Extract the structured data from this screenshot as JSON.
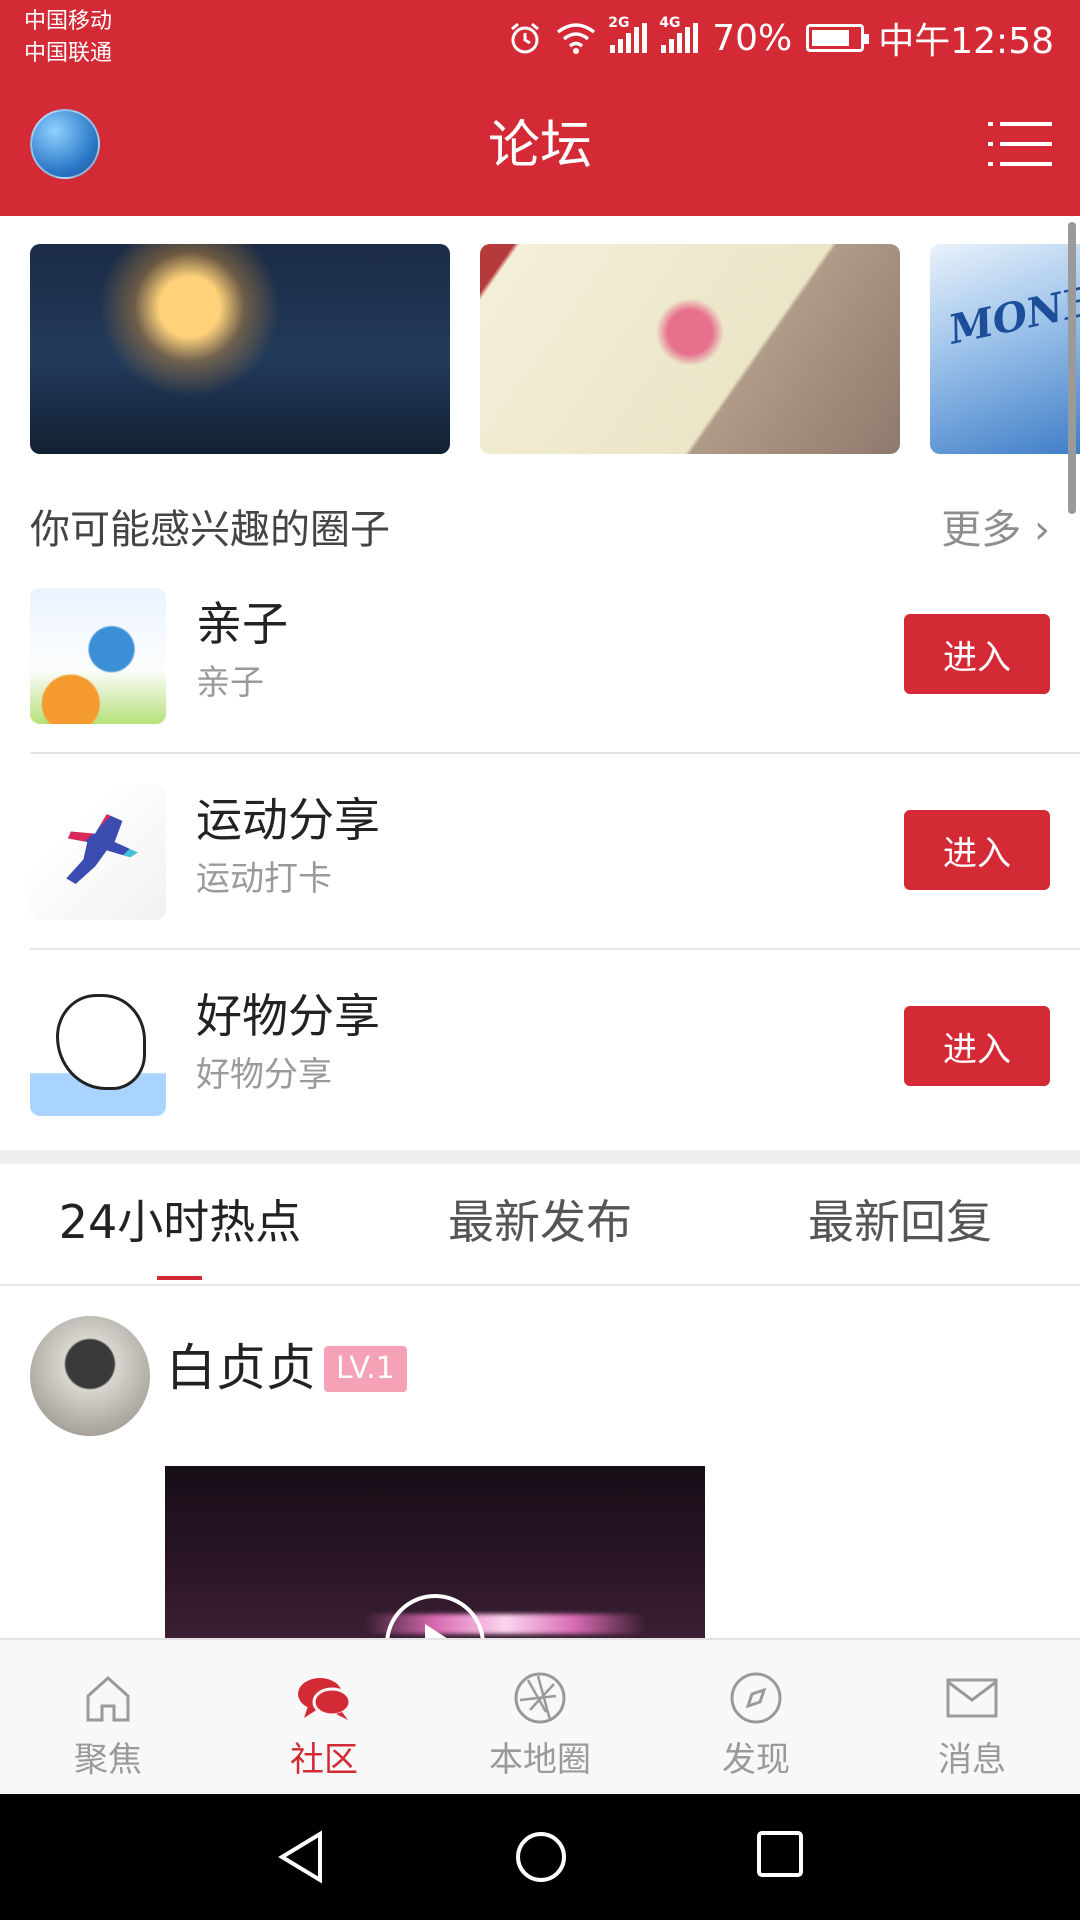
{
  "status_bar": {
    "carrier1": "中国移动",
    "carrier2": "中国联通",
    "net1": "2G",
    "net2": "4G",
    "battery": "70%",
    "battery_level": 0.7,
    "time": "中午12:58"
  },
  "header": {
    "title": "论坛"
  },
  "circles_section": {
    "title": "你可能感兴趣的圈子",
    "more": "更多",
    "items": [
      {
        "name": "亲子",
        "sub": "亲子",
        "button": "进入"
      },
      {
        "name": "运动分享",
        "sub": "运动打卡",
        "button": "进入"
      },
      {
        "name": "好物分享",
        "sub": "好物分享",
        "button": "进入"
      }
    ]
  },
  "banner": {
    "items": [
      "sky-lantern",
      "notebook-flower",
      "MONE"
    ]
  },
  "tabs": [
    {
      "label": "24小时热点",
      "active": true
    },
    {
      "label": "最新发布",
      "active": false
    },
    {
      "label": "最新回复",
      "active": false
    }
  ],
  "post": {
    "user": "白贞贞",
    "level": "LV.1"
  },
  "bottom_nav": [
    {
      "label": "聚焦",
      "icon": "home-icon"
    },
    {
      "label": "社区",
      "icon": "chat-bubbles-icon",
      "active": true
    },
    {
      "label": "本地圈",
      "icon": "aperture-icon"
    },
    {
      "label": "发现",
      "icon": "compass-icon"
    },
    {
      "label": "消息",
      "icon": "envelope-icon"
    }
  ],
  "colors": {
    "brand": "#d32a36",
    "level_badge": "#f6a2b6"
  }
}
